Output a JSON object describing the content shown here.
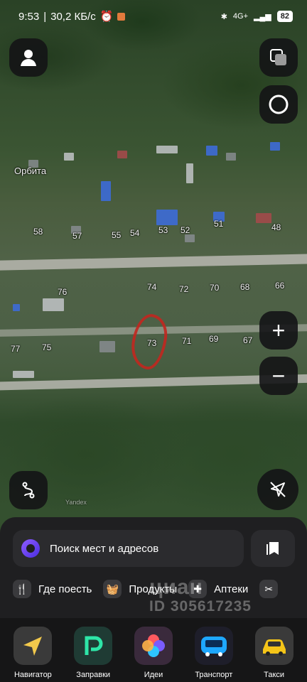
{
  "status_bar": {
    "time": "9:53",
    "speed": "30,2 КБ/с",
    "network": "4G+",
    "battery": "82"
  },
  "map": {
    "place_label": "Орбита",
    "house_numbers_row1": [
      "58",
      "57",
      "55",
      "54",
      "53",
      "52",
      "51",
      "48"
    ],
    "house_numbers_row2": [
      "76",
      "74",
      "72",
      "70",
      "68",
      "66"
    ],
    "house_numbers_row3": [
      "77",
      "75",
      "73",
      "71",
      "69",
      "67"
    ],
    "yandex_mark": "Yandex"
  },
  "controls": {
    "profile_icon": "person-icon",
    "layers_icon": "layers-icon",
    "alice_icon": "circle-icon",
    "zoom_in": "+",
    "zoom_out": "−",
    "route_icon": "route-icon",
    "location_icon": "location-off-icon"
  },
  "search": {
    "placeholder": "Поиск мест и адресов"
  },
  "categories": [
    {
      "label": "Где поесть",
      "icon": "fork-knife-icon"
    },
    {
      "label": "Продукты",
      "icon": "basket-icon"
    },
    {
      "label": "Аптеки",
      "icon": "plus-icon"
    },
    {
      "label": "",
      "icon": "scissors-icon"
    }
  ],
  "watermark": {
    "line1": "циан",
    "line2": "ID 305617235"
  },
  "dock": [
    {
      "label": "Навигатор",
      "color": "#3a3a3a"
    },
    {
      "label": "Заправки",
      "color": "#1f3b34"
    },
    {
      "label": "Идеи",
      "color": "#3a2a3c"
    },
    {
      "label": "Транспорт",
      "color": "#1e1e2a"
    },
    {
      "label": "Такси",
      "color": "#3a3a3a"
    }
  ]
}
